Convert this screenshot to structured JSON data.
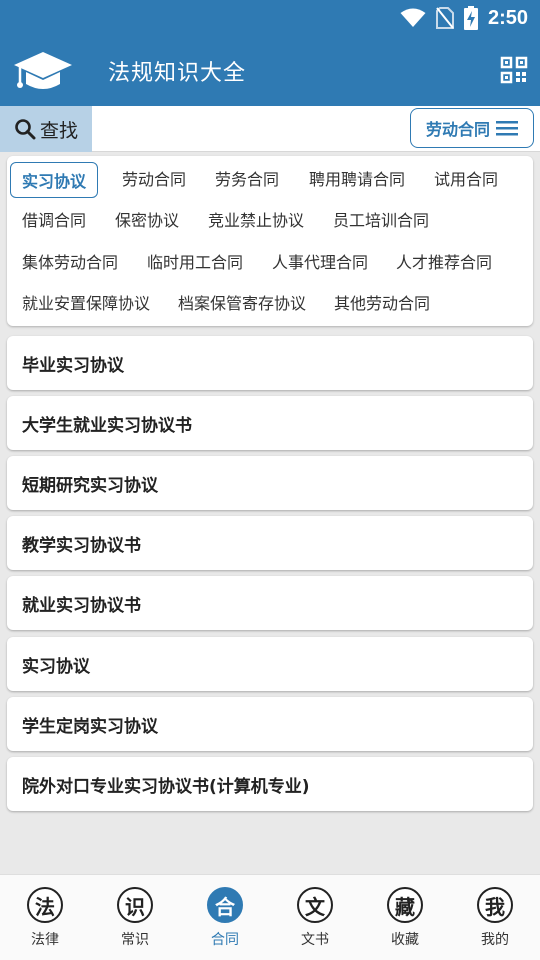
{
  "status_bar": {
    "time": "2:50",
    "icons": [
      "wifi-icon",
      "no-sim-icon",
      "battery-charging-icon"
    ]
  },
  "app_bar": {
    "title": "法规知识大全",
    "logo_icon": "graduation-cap-icon",
    "action_icon": "qr-scan-icon"
  },
  "search": {
    "label": "查找",
    "icon": "search-icon"
  },
  "category_button": {
    "label": "劳动合同",
    "icon": "menu-icon"
  },
  "tags": [
    "实习协议",
    "劳动合同",
    "劳务合同",
    "聘用聘请合同",
    "试用合同",
    "借调合同",
    "保密协议",
    "竞业禁止协议",
    "员工培训合同",
    "集体劳动合同",
    "临时用工合同",
    "人事代理合同",
    "人才推荐合同",
    "就业安置保障协议",
    "档案保管寄存协议",
    "其他劳动合同"
  ],
  "active_tag": "实习协议",
  "list": [
    "毕业实习协议",
    "大学生就业实习协议书",
    "短期研究实习协议",
    "教学实习协议书",
    "就业实习协议书",
    "实习协议",
    "学生定岗实习协议",
    "院外对口专业实习协议书(计算机专业)"
  ],
  "nav": [
    {
      "glyph": "法",
      "label": "法律"
    },
    {
      "glyph": "识",
      "label": "常识"
    },
    {
      "glyph": "合",
      "label": "合同"
    },
    {
      "glyph": "文",
      "label": "文书"
    },
    {
      "glyph": "藏",
      "label": "收藏"
    },
    {
      "glyph": "我",
      "label": "我的"
    }
  ],
  "active_nav": "合同",
  "colors": {
    "primary": "#2f7ab3",
    "search_bg": "#b7d1e6",
    "page_bg": "#e9e9e9"
  }
}
